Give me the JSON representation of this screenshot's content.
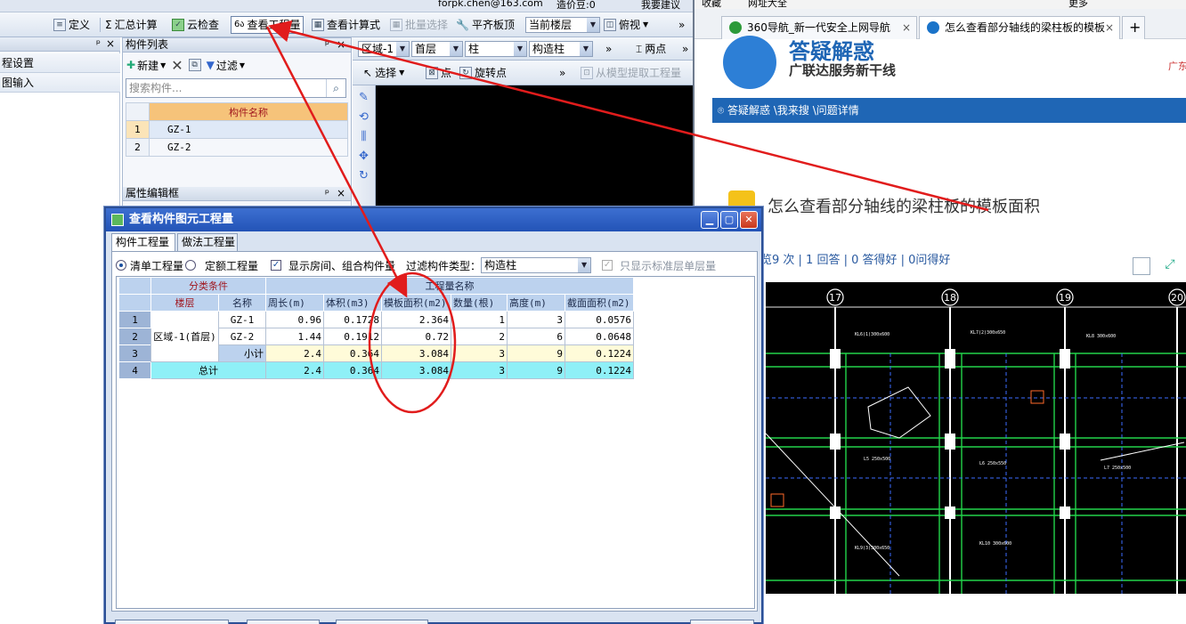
{
  "app": {
    "topstrip": {
      "email": "forpk.chen@163.com",
      "cost": "造价豆:0",
      "suggest": "我要建议"
    },
    "toolbar": {
      "define": "定义",
      "summary": "汇总计算",
      "cloud_check": "云检查",
      "view_quantity": "查看工程量",
      "view_formula": "查看计算式",
      "batch_select": "批量选择",
      "level_top": "平齐板顶",
      "current_floor": "当前楼层",
      "top_view": "俯视"
    },
    "left_panel": {
      "items": [
        "程设置",
        "图输入"
      ]
    },
    "component_list": {
      "title": "构件列表",
      "new_label": "新建",
      "filter_label": "过滤",
      "search_placeholder": "搜索构件...",
      "column_header": "构件名称",
      "rows": [
        {
          "no": "1",
          "name": "GZ-1"
        },
        {
          "no": "2",
          "name": "GZ-2"
        }
      ]
    },
    "property_panel": {
      "title": "属性编辑框"
    },
    "canvas_bar": {
      "region": "区域-1",
      "floor": "首层",
      "type": "柱",
      "subtype": "构造柱",
      "two_points": "两点",
      "select": "选择",
      "point": "点",
      "rotate_point": "旋转点",
      "extract": "从模型提取工程量"
    }
  },
  "browser": {
    "bookmarks": [
      "收藏",
      "网址大全",
      "更多"
    ],
    "tabs": [
      {
        "label": "360导航_新一代安全上网导航",
        "close": "×"
      },
      {
        "label": "怎么查看部分轴线的梁柱板的模板",
        "close": "×"
      }
    ],
    "new_tab": "+",
    "banner": {
      "heading": "答疑解惑",
      "slogan": "广联达服务新干线",
      "right_text": "广东"
    },
    "breadcrumb": "答疑解惑 \\我来搜 \\问题详情",
    "question": {
      "title": "怎么查看部分轴线的梁柱板的模板面积",
      "stats": "览9 次 | 1 回答 | 0 答得好 | 0问得好"
    },
    "cad_axes": [
      "17",
      "18",
      "19",
      "20"
    ]
  },
  "dialog": {
    "title": "查看构件图元工程量",
    "tabs": [
      "构件工程量",
      "做法工程量"
    ],
    "options": {
      "bill_quantity": "清单工程量",
      "quota_quantity": "定额工程量",
      "show_room": "显示房间、组合构件量",
      "filter_type_label": "过滤构件类型：",
      "filter_type_value": "构造柱",
      "only_standard": "只显示标准层单层量"
    },
    "table": {
      "group_header": "分类条件",
      "quantity_header": "工程量名称",
      "col_floor": "楼层",
      "col_name": "名称",
      "cols": [
        "周长(m)",
        "体积(m3)",
        "模板面积(m2)",
        "数量(根)",
        "高度(m)",
        "截面面积(m2)"
      ],
      "area": "区域-1(首层)",
      "rows": [
        {
          "no": "1",
          "name": "GZ-1",
          "values": [
            "0.96",
            "0.1728",
            "2.364",
            "1",
            "3",
            "0.0576"
          ]
        },
        {
          "no": "2",
          "name": "GZ-2",
          "values": [
            "1.44",
            "0.1912",
            "0.72",
            "2",
            "6",
            "0.0648"
          ]
        },
        {
          "no": "3",
          "name": "小计",
          "values": [
            "2.4",
            "0.364",
            "3.084",
            "3",
            "9",
            "0.1224"
          ]
        },
        {
          "no": "4",
          "name": "总计",
          "values": [
            "2.4",
            "0.364",
            "3.084",
            "3",
            "9",
            "0.1224"
          ]
        }
      ]
    }
  },
  "colors": {
    "dialog_title": "#2353b7",
    "header_text": "#a0171f",
    "total_row": "#8ff0f7",
    "annotation": "#e11c1c",
    "browser_bar": "#1f66b5"
  }
}
